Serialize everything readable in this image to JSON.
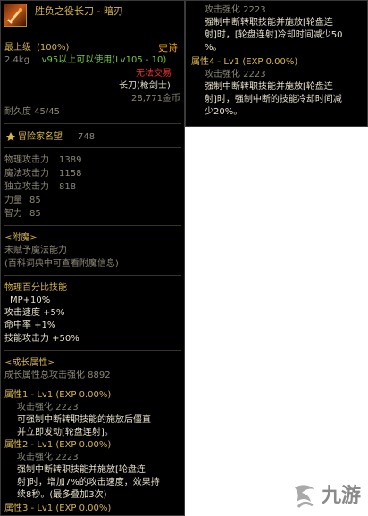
{
  "item": {
    "name": "胜负之役长刀 - 暗刃",
    "level_label": "最上级",
    "level_pct": "(100%)",
    "rarity": "史诗",
    "weight": "2.4kg",
    "use_req": "Lv95以上可以使用(Lv105 - 10)",
    "trade": "无法交易",
    "type": "长刀(枪剑士)",
    "price": "28,771金币",
    "durability": "耐久度 45/45",
    "renown_label": "冒险家名望",
    "renown_value": "748"
  },
  "stats": [
    {
      "label": "物理攻击力",
      "value": "1389"
    },
    {
      "label": "魔法攻击力",
      "value": "1158"
    },
    {
      "label": "独立攻击力",
      "value": "818"
    },
    {
      "label": "力量",
      "value": "85"
    },
    {
      "label": "智力",
      "value": "85"
    }
  ],
  "enchant": {
    "title": "<附魔>",
    "line1": "未赋予魔法能力",
    "line2": "(百科词典中可查看附魔信息)"
  },
  "skill": {
    "title": "物理百分比技能",
    "mp": "MP+10%",
    "attack_speed": "攻击速度 +5%",
    "hit_rate": "命中率 +1%",
    "skill_atk": "技能攻击力 +50%"
  },
  "growth": {
    "title": "<成长属性>",
    "total": "成长属性总攻击强化 8892",
    "attr1_head": "属性1 - Lv1 (EXP 0.00%)",
    "attr1_power": "攻击强化 2223",
    "attr1_desc1": "可强制中断转职技能的施放后僵直",
    "attr1_desc2": "并立即发动[轮盘连射]。",
    "attr2_head": "属性2 - Lv1 (EXP 0.00%)",
    "attr2_power": "攻击强化 2223",
    "attr2_desc1": "强制中断转职技能并施放[轮盘连",
    "attr2_desc2": "射]时，增加7%的攻击速度，效果持",
    "attr2_desc3": "续8秒。(最多叠加3次)",
    "attr3_head": "属性3 - Lv1 (EXP 0.00%)"
  },
  "right": {
    "attr3_power": "攻击强化 2223",
    "attr3_desc1": "强制中断转职技能并施放[轮盘连",
    "attr3_desc2": "射]时，[轮盘连射]冷却时间减少50",
    "attr3_desc3": "%。",
    "attr4_head": "属性4 - Lv1 (EXP 0.00%)",
    "attr4_power": "攻击强化 2223",
    "attr4_desc1": "强制中断转职技能并施放[轮盘连",
    "attr4_desc2": "射]时，强制中断的技能冷却时间减",
    "attr4_desc3": "少20%。"
  },
  "watermark": {
    "text": "九游"
  },
  "colors": {
    "title": "#d6b54e",
    "rarity": "#f0a000",
    "untradeable": "#e83030",
    "requirement": "#72c83a"
  },
  "icons": [
    "sword-icon",
    "renown-icon",
    "jiuyou-logo-icon"
  ]
}
